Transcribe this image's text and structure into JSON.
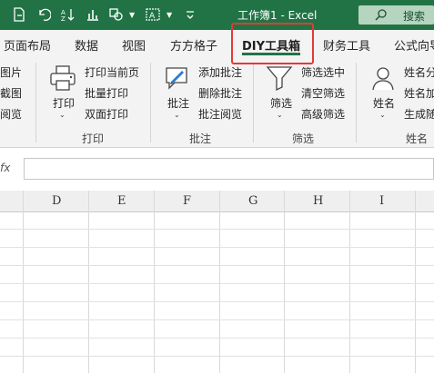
{
  "titlebar": {
    "title": "工作簿1  -  Excel",
    "search_label": "搜索"
  },
  "tabs": [
    "页面布局",
    "数据",
    "视图",
    "方方格子",
    "DIY工具箱",
    "财务工具",
    "公式向导"
  ],
  "active_tab": "DIY工具箱",
  "ribbon": {
    "left_partial": [
      "图片",
      "截图",
      "阅览"
    ],
    "print": {
      "big_label": "打印",
      "items": [
        "打印当前页",
        "批量打印",
        "双面打印"
      ],
      "group": "打印"
    },
    "annotate": {
      "big_label": "批注",
      "items": [
        "添加批注",
        "删除批注",
        "批注阅览"
      ],
      "group": "批注"
    },
    "filter": {
      "big_label": "筛选",
      "items": [
        "筛选选中",
        "清空筛选",
        "高级筛选"
      ],
      "group": "筛选"
    },
    "name": {
      "big_label": "姓名",
      "items": [
        "姓名分",
        "姓名加",
        "生成随"
      ],
      "group": "姓名"
    }
  },
  "formula_bar": {
    "fx": "fx",
    "value": ""
  },
  "columns": [
    "D",
    "E",
    "F",
    "G",
    "H",
    "I"
  ],
  "colors": {
    "accent": "#217346",
    "highlight": "#e53935"
  }
}
